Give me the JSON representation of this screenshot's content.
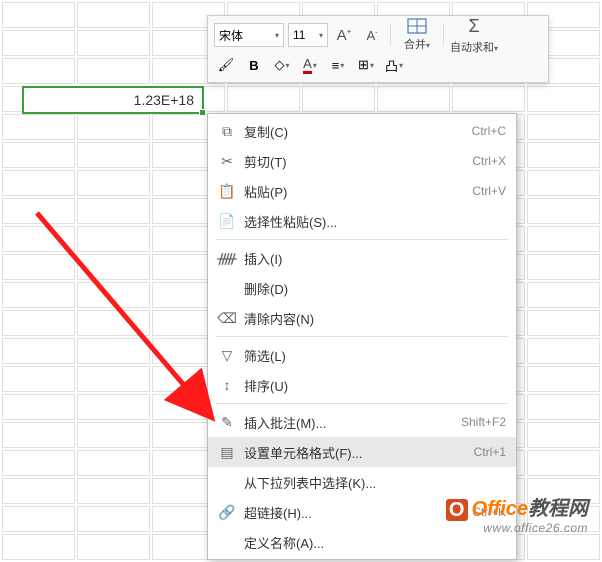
{
  "cell": {
    "value": "1.23E+18"
  },
  "toolbar": {
    "font": "宋体",
    "size": "11",
    "merge_label": "合并",
    "autosum_label": "自动求和"
  },
  "menu": {
    "items": [
      {
        "icon": "copy",
        "label": "复制(C)",
        "shortcut": "Ctrl+C"
      },
      {
        "icon": "cut",
        "label": "剪切(T)",
        "shortcut": "Ctrl+X"
      },
      {
        "icon": "paste",
        "label": "粘贴(P)",
        "shortcut": "Ctrl+V"
      },
      {
        "icon": "paste-special",
        "label": "选择性粘贴(S)...",
        "shortcut": ""
      },
      {
        "icon": "insert",
        "label": "插入(I)",
        "shortcut": ""
      },
      {
        "icon": "",
        "label": "删除(D)",
        "shortcut": ""
      },
      {
        "icon": "clear",
        "label": "清除内容(N)",
        "shortcut": ""
      },
      {
        "icon": "filter",
        "label": "筛选(L)",
        "shortcut": ""
      },
      {
        "icon": "sort",
        "label": "排序(U)",
        "shortcut": ""
      },
      {
        "icon": "comment",
        "label": "插入批注(M)...",
        "shortcut": "Shift+F2"
      },
      {
        "icon": "format",
        "label": "设置单元格格式(F)...",
        "shortcut": "Ctrl+1",
        "hl": true
      },
      {
        "icon": "",
        "label": "从下拉列表中选择(K)...",
        "shortcut": ""
      },
      {
        "icon": "link",
        "label": "超链接(H)...",
        "shortcut": "Ctrl+K"
      },
      {
        "icon": "",
        "label": "定义名称(A)...",
        "shortcut": ""
      }
    ]
  },
  "watermark": {
    "brand_en": "Office",
    "brand_cn": "教程网",
    "url": "www.office26.com"
  }
}
